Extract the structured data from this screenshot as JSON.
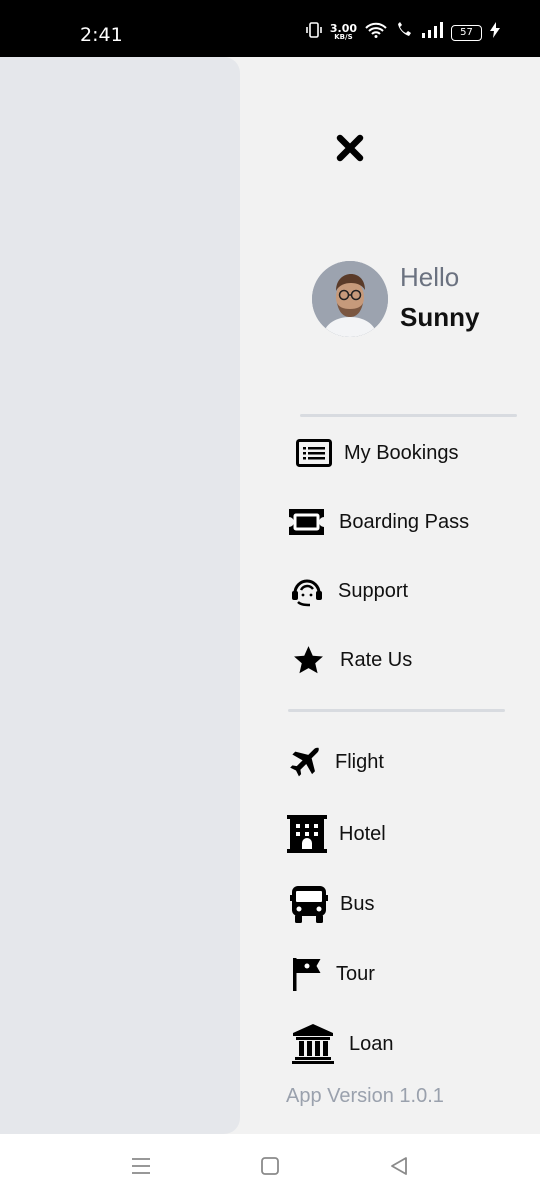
{
  "status_bar": {
    "time": "2:41",
    "speed_value": "3.00",
    "speed_unit": "KB/S",
    "battery": "57"
  },
  "drawer": {
    "greeting": "Hello",
    "user_name": "Sunny",
    "account_menu": [
      {
        "label": "My Bookings",
        "icon": "list-icon"
      },
      {
        "label": "Boarding Pass",
        "icon": "ticket-icon"
      },
      {
        "label": "Support",
        "icon": "headset-icon"
      },
      {
        "label": "Rate Us",
        "icon": "star-icon"
      }
    ],
    "service_menu": [
      {
        "label": "Flight",
        "icon": "plane-icon"
      },
      {
        "label": "Hotel",
        "icon": "hotel-icon"
      },
      {
        "label": "Bus",
        "icon": "bus-icon"
      },
      {
        "label": "Tour",
        "icon": "flag-icon"
      },
      {
        "label": "Loan",
        "icon": "bank-icon"
      }
    ],
    "version": "App Version 1.0.1"
  },
  "colors": {
    "drawer_bg": "#f2f2f2",
    "scrim_panel": "#e5e7eb",
    "greeting": "#6b7280",
    "version": "#9aa1ad"
  }
}
